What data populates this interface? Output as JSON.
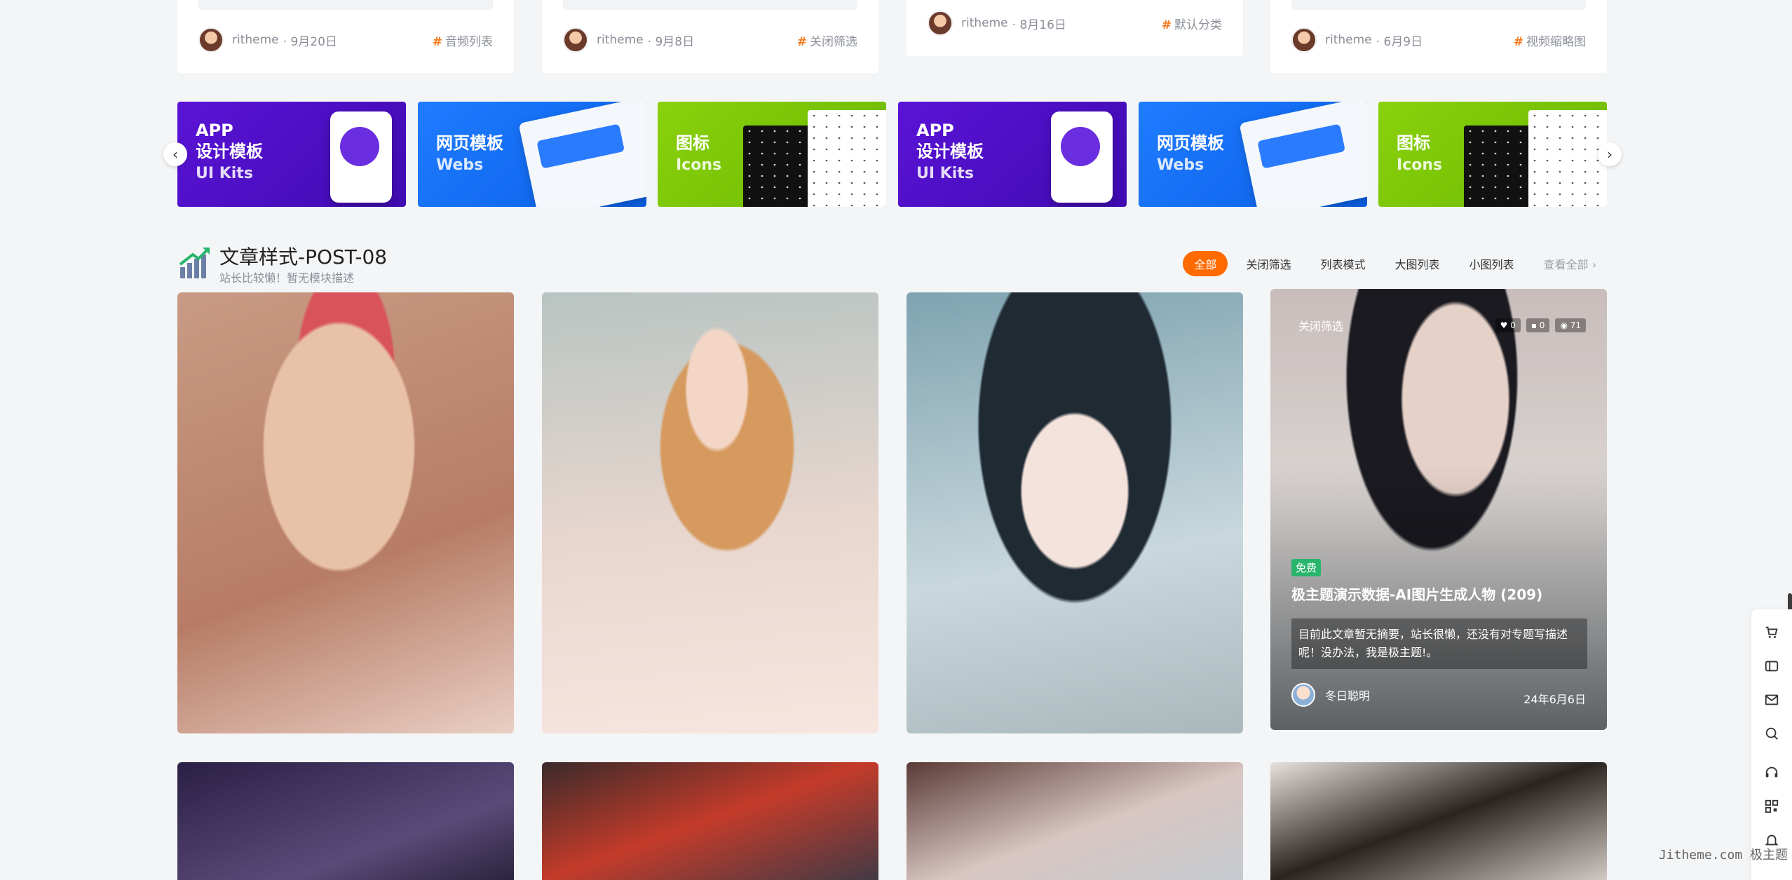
{
  "top_cards": [
    {
      "author": "ritheme",
      "date": "9月20日",
      "tag": "音频列表"
    },
    {
      "author": "ritheme",
      "date": "9月8日",
      "tag": "关闭筛选"
    },
    {
      "author": "ritheme",
      "date": "8月16日",
      "tag": "默认分类"
    },
    {
      "author": "ritheme",
      "date": "6月9日",
      "tag": "视频缩略图"
    }
  ],
  "slider": {
    "prev": "‹",
    "next": "›",
    "banners": [
      {
        "line1": "APP",
        "line2": "设计模板",
        "sub": "UI Kits",
        "color": "purple"
      },
      {
        "line1": "网页模板",
        "line2": "",
        "sub": "Webs",
        "color": "blue"
      },
      {
        "line1": "图标",
        "line2": "",
        "sub": "Icons",
        "color": "green"
      },
      {
        "line1": "APP",
        "line2": "设计模板",
        "sub": "UI Kits",
        "color": "purple"
      },
      {
        "line1": "网页模板",
        "line2": "",
        "sub": "Webs",
        "color": "blue"
      },
      {
        "line1": "图标",
        "line2": "",
        "sub": "Icons",
        "color": "green"
      }
    ]
  },
  "section": {
    "title": "文章样式-POST-08",
    "desc": "站长比较懒！暂无模块描述",
    "filters": [
      "全部",
      "关闭筛选",
      "列表模式",
      "大图列表",
      "小图列表"
    ],
    "more": "查看全部 ›"
  },
  "featured": {
    "category": "关闭筛选",
    "likes": "♥ 0",
    "comments": "▪ 0",
    "views": "◉ 71",
    "badge": "免费",
    "title": "极主题演示数据-AI图片生成人物 (209)",
    "excerpt": "目前此文章暂无摘要，站长很懒，还没有对专题写描述呢！没办法，我是极主题!。",
    "author": "冬日聪明",
    "date": "24年6月6日"
  },
  "toolbar_icons": [
    "cart-icon",
    "ticket-icon",
    "mail-icon",
    "search-icon",
    "headset-icon",
    "qrcode-icon",
    "bell-icon"
  ],
  "watermark": "Jitheme.com 极主题",
  "colors": {
    "accent": "#ff6a00",
    "tag_hash": "#f47b20",
    "badge_free": "#2ab56c"
  }
}
